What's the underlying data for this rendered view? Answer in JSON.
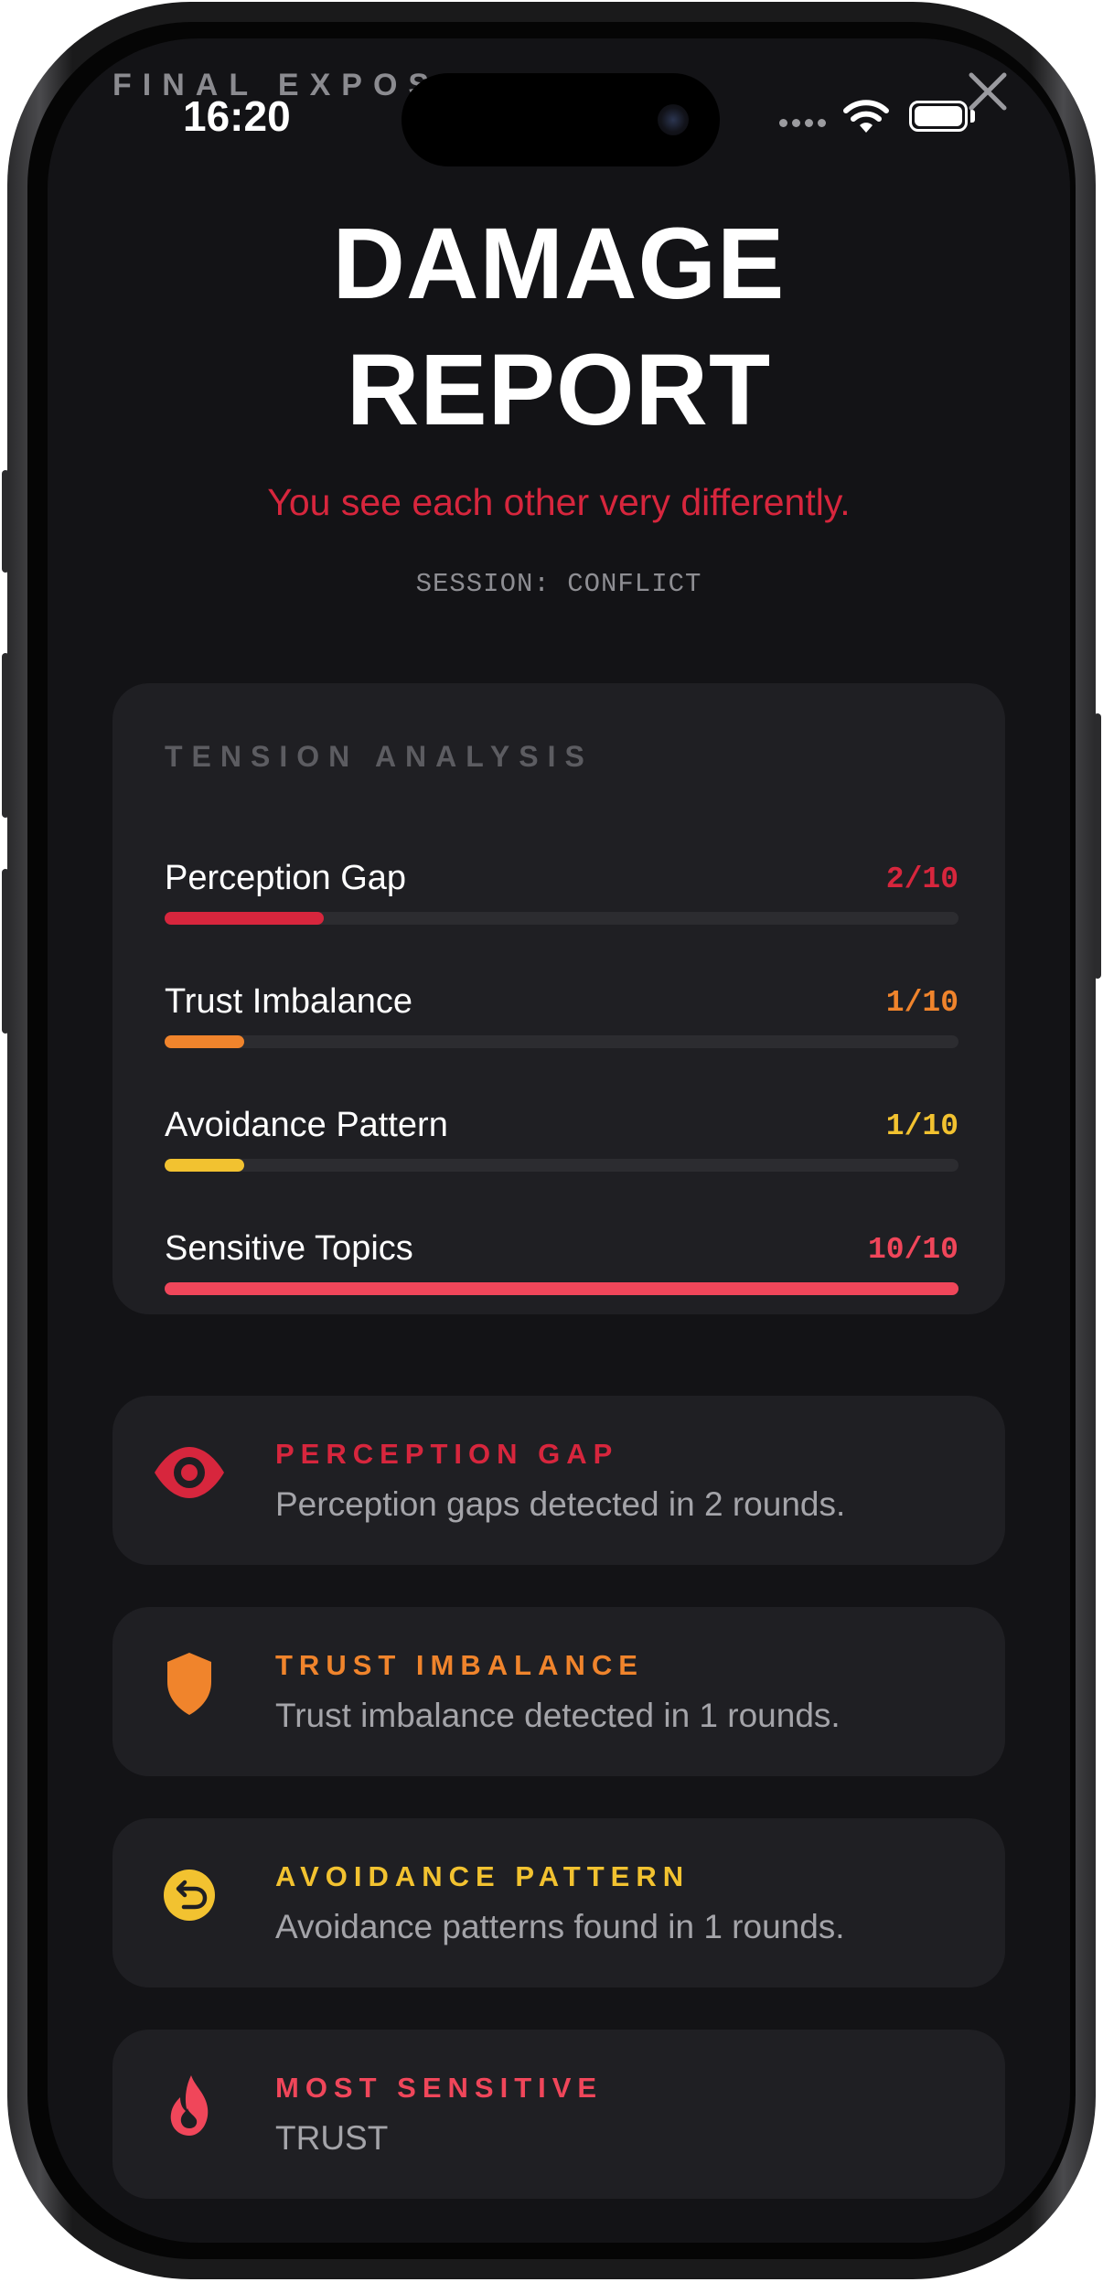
{
  "status_bar": {
    "time": "16:20"
  },
  "header": {
    "top_label": "FINAL EXPOSU",
    "title_line1": "DAMAGE",
    "title_line2": "REPORT",
    "subtitle": "You see each other very differently.",
    "session": "SESSION: CONFLICT"
  },
  "tension": {
    "title": "TENSION ANALYSIS",
    "metrics": [
      {
        "label": "Perception Gap",
        "score": "2/10",
        "value": 2,
        "max": 10,
        "color": "#d7263d"
      },
      {
        "label": "Trust Imbalance",
        "score": "1/10",
        "value": 1,
        "max": 10,
        "color": "#f0842c"
      },
      {
        "label": "Avoidance Pattern",
        "score": "1/10",
        "value": 1,
        "max": 10,
        "color": "#f2c230"
      },
      {
        "label": "Sensitive Topics",
        "score": "10/10",
        "value": 10,
        "max": 10,
        "color": "#f0465a"
      }
    ]
  },
  "insights": [
    {
      "icon": "eye-icon",
      "title": "PERCEPTION GAP",
      "text": "Perception gaps detected in 2 rounds.",
      "color": "#d7263d"
    },
    {
      "icon": "shield-icon",
      "title": "TRUST IMBALANCE",
      "text": "Trust imbalance detected in 1 rounds.",
      "color": "#f0842c"
    },
    {
      "icon": "undo-arrow-icon",
      "title": "AVOIDANCE PATTERN",
      "text": "Avoidance patterns found in 1 rounds.",
      "color": "#f2c230"
    },
    {
      "icon": "flame-icon",
      "title": "MOST SENSITIVE",
      "text": "TRUST",
      "color": "#f0465a"
    }
  ]
}
